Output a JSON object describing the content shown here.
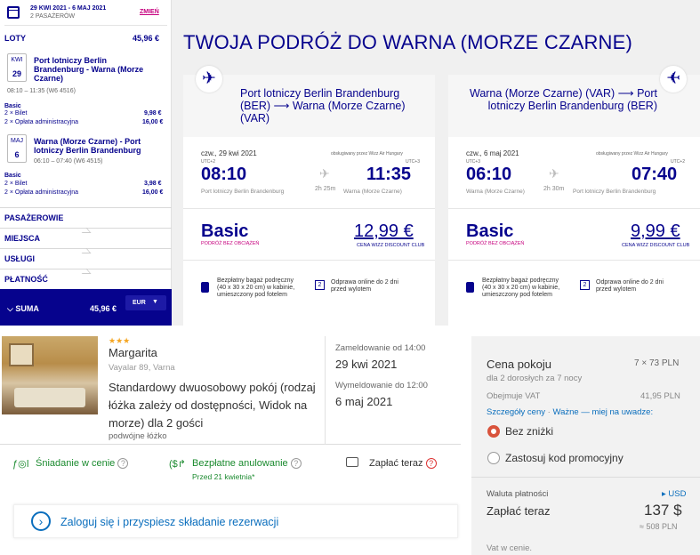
{
  "booking": {
    "dates": "29 KWI 2021 - 6 MAJ 2021",
    "passengers": "2 PASAŻERÓW",
    "change": "ZMIEŃ"
  },
  "flights_section": {
    "label": "LOTY",
    "total": "45,96 €"
  },
  "flight1": {
    "month": "KWI",
    "day": "29",
    "route": "Port lotniczy Berlin Brandenburg - Warna (Morze Czarne)",
    "time": "08:10 – 11:35 (W6 4516)",
    "fare": "Basic",
    "l1": "2 × Bilet",
    "v1": "9,98 €",
    "l2": "2 × Opłata administracyjna",
    "v2": "16,00 €"
  },
  "flight2": {
    "month": "MAJ",
    "day": "6",
    "route": "Warna (Morze Czarne) - Port lotniczy Berlin Brandenburg",
    "time": "06:10 – 07:40 (W6 4515)",
    "fare": "Basic",
    "l1": "2 × Bilet",
    "v1": "3,98 €",
    "l2": "2 × Opłata administracyjna",
    "v2": "16,00 €"
  },
  "sections": [
    "PASAŻEROWIE",
    "MIEJSCA",
    "USŁUGI",
    "PŁATNOŚĆ"
  ],
  "suma": {
    "label": "SUMA",
    "value": "45,96 €",
    "currency": "EUR"
  },
  "page_title": "TWOJA PODRÓŻ DO WARNA (MORZE CZARNE)",
  "card1": {
    "title": "Port lotniczy Berlin Brandenburg (BER) ⟶ Warna (Morze Czarne) (VAR)",
    "date": "czw., 29 kwi 2021",
    "operator": "obsługiwany przez Wizz Air Hungary",
    "utc_dep": "UTC+2",
    "utc_arr": "UTC+3",
    "dep": "08:10",
    "arr": "11:35",
    "duration": "2h 25m",
    "from": "Port lotniczy Berlin Brandenburg",
    "to": "Warna (Morze Czarne)",
    "fare": "Basic",
    "fare_sub": "PODRÓŻ BEZ OBCIĄŻEŃ",
    "price": "12,99 €",
    "price_sub": "CENA WIZZ DISCOUNT CLUB",
    "bag": "Bezpłatny bagaż podręczny (40 x 30 x 20 cm) w kabinie, umieszczony pod fotelem",
    "checkin": "Odprawa online do 2 dni przed wylotem"
  },
  "card2": {
    "title": "Warna (Morze Czarne) (VAR) ⟶ Port lotniczy Berlin Brandenburg (BER)",
    "date": "czw., 6 maj 2021",
    "operator": "obsługiwany przez Wizz Air Hungary",
    "utc_dep": "UTC+3",
    "utc_arr": "UTC+2",
    "dep": "06:10",
    "arr": "07:40",
    "duration": "2h 30m",
    "from": "Warna (Morze Czarne)",
    "to": "Port lotniczy Berlin Brandenburg",
    "fare": "Basic",
    "fare_sub": "PODRÓŻ BEZ OBCIĄŻEŃ",
    "price": "9,99 €",
    "price_sub": "CENA WIZZ DISCOUNT CLUB",
    "bag": "Bezpłatny bagaż podręczny (40 x 30 x 20 cm) w kabinie, umieszczony pod fotelem",
    "checkin": "Odprawa online do 2 dni przed wylotem"
  },
  "hotel": {
    "stars": "★★★",
    "name": "Margarita",
    "address": "Vayalar 89, Varna",
    "room": "Standardowy dwuosobowy pokój (rodzaj łóżka zależy od dostępności, Widok na morze) dla 2 gości",
    "bed": "podwójne łóżko",
    "checkin_label": "Zameldowanie od 14:00",
    "checkin_date": "29 kwi 2021",
    "checkout_label": "Wymeldowanie do 12:00",
    "checkout_date": "6 maj 2021",
    "breakfast": "Śniadanie w cenie",
    "cancel": "Bezpłatne anulowanie",
    "cancel_sub": "Przed 21 kwietnia*",
    "pay": "Zapłać teraz"
  },
  "login": "Zaloguj się i przyspiesz składanie rezerwacji",
  "price": {
    "label": "Cena pokoju",
    "nights": "7 × 73 PLN",
    "sub": "dla 2 dorosłych za 7 nocy",
    "vat_label": "Obejmuje VAT",
    "vat": "41,95 PLN",
    "details": "Szczegóły ceny",
    "dot": " · ",
    "important": "Ważne — miej na uwadze:",
    "opt1": "Bez zniżki",
    "opt2": "Zastosuj kod promocyjny",
    "currency_label": "Waluta płatności",
    "currency": "▸ USD",
    "pay_label": "Zapłać teraz",
    "pay_value": "137 $",
    "pay_pln": "≈ 508 PLN",
    "vat_note": "Vat w cenie."
  }
}
